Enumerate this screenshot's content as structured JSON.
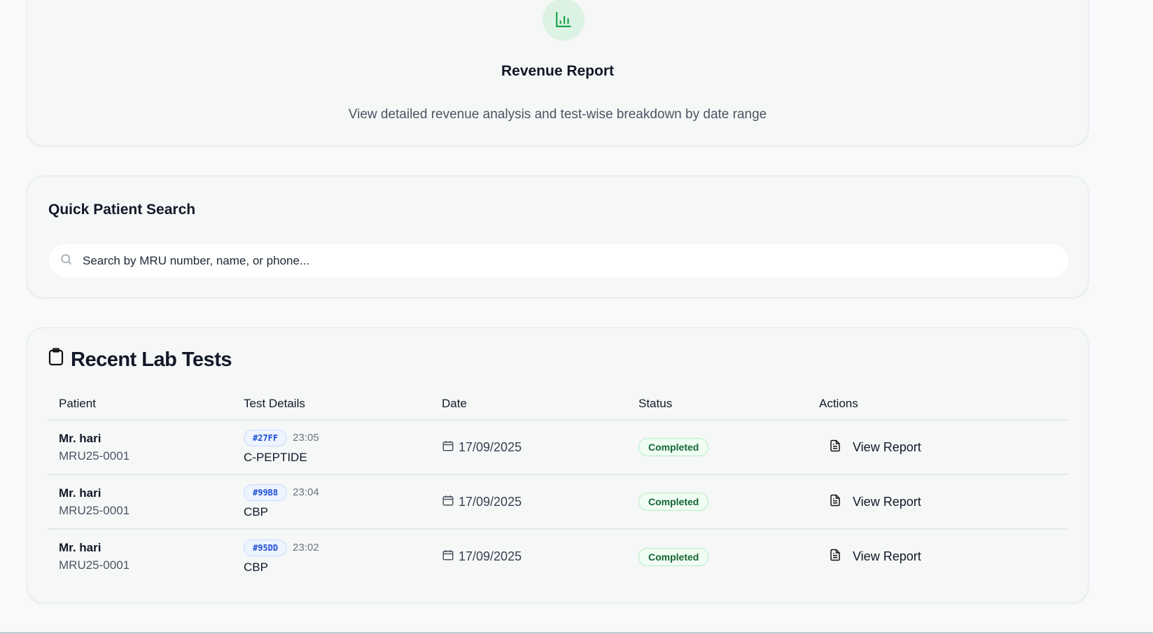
{
  "revenue_card": {
    "title": "Revenue Report",
    "description": "View detailed revenue analysis and test-wise breakdown by date range",
    "icon": "bar-chart-icon",
    "accent": "#16a34a"
  },
  "search_card": {
    "title": "Quick Patient Search",
    "placeholder": "Search by MRU number, name, or phone..."
  },
  "lab_tests": {
    "title": "Recent Lab Tests",
    "columns": [
      "Patient",
      "Test Details",
      "Date",
      "Status",
      "Actions"
    ],
    "rows": [
      {
        "name": "Mr. hari",
        "mru": "MRU25-0001",
        "code": "#27FF",
        "time": "23:05",
        "test": "C-PEPTIDE",
        "date": "17/09/2025",
        "status": "Completed",
        "action": "View Report"
      },
      {
        "name": "Mr. hari",
        "mru": "MRU25-0001",
        "code": "#99B8",
        "time": "23:04",
        "test": "CBP",
        "date": "17/09/2025",
        "status": "Completed",
        "action": "View Report"
      },
      {
        "name": "Mr. hari",
        "mru": "MRU25-0001",
        "code": "#95DD",
        "time": "23:02",
        "test": "CBP",
        "date": "17/09/2025",
        "status": "Completed",
        "action": "View Report"
      }
    ]
  }
}
